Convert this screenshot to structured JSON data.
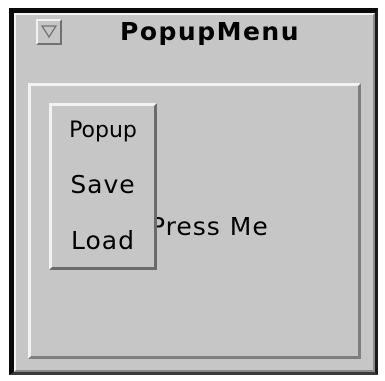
{
  "window": {
    "title": "PopupMenu",
    "window_menu_icon": "triangle-down-icon"
  },
  "content": {
    "button_label": "Press Me"
  },
  "popup": {
    "title": "Popup",
    "items": [
      {
        "label": "Save"
      },
      {
        "label": "Load"
      }
    ]
  }
}
